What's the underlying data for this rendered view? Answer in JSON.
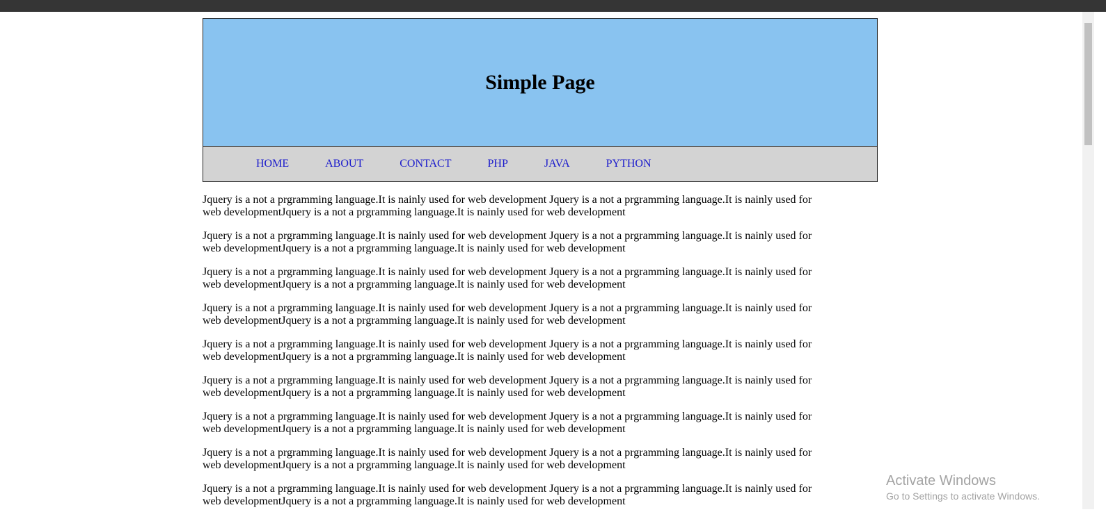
{
  "header": {
    "title": "Simple Page"
  },
  "nav": {
    "items": [
      "HOME",
      "ABOUT",
      "CONTACT",
      "PHP",
      "JAVA",
      "PYTHON"
    ]
  },
  "content": {
    "paragraphs": [
      "Jquery is a not a prgramming language.It is nainly used for web development Jquery is a not a prgramming language.It is nainly used for web developmentJquery is a not a prgramming language.It is nainly used for web development",
      "Jquery is a not a prgramming language.It is nainly used for web development Jquery is a not a prgramming language.It is nainly used for web developmentJquery is a not a prgramming language.It is nainly used for web development",
      "Jquery is a not a prgramming language.It is nainly used for web development Jquery is a not a prgramming language.It is nainly used for web developmentJquery is a not a prgramming language.It is nainly used for web development",
      "Jquery is a not a prgramming language.It is nainly used for web development Jquery is a not a prgramming language.It is nainly used for web developmentJquery is a not a prgramming language.It is nainly used for web development",
      "Jquery is a not a prgramming language.It is nainly used for web development Jquery is a not a prgramming language.It is nainly used for web developmentJquery is a not a prgramming language.It is nainly used for web development",
      "Jquery is a not a prgramming language.It is nainly used for web development Jquery is a not a prgramming language.It is nainly used for web developmentJquery is a not a prgramming language.It is nainly used for web development",
      "Jquery is a not a prgramming language.It is nainly used for web development Jquery is a not a prgramming language.It is nainly used for web developmentJquery is a not a prgramming language.It is nainly used for web development",
      "Jquery is a not a prgramming language.It is nainly used for web development Jquery is a not a prgramming language.It is nainly used for web developmentJquery is a not a prgramming language.It is nainly used for web development",
      "Jquery is a not a prgramming language.It is nainly used for web development Jquery is a not a prgramming language.It is nainly used for web developmentJquery is a not a prgramming language.It is nainly used for web development"
    ]
  },
  "watermark": {
    "line1": "Activate Windows",
    "line2": "Go to Settings to activate Windows."
  },
  "colors": {
    "header_bg": "#89c3f0",
    "nav_bg": "#d3d3d3",
    "link": "#1a1acc",
    "browser_bar": "#353535"
  }
}
